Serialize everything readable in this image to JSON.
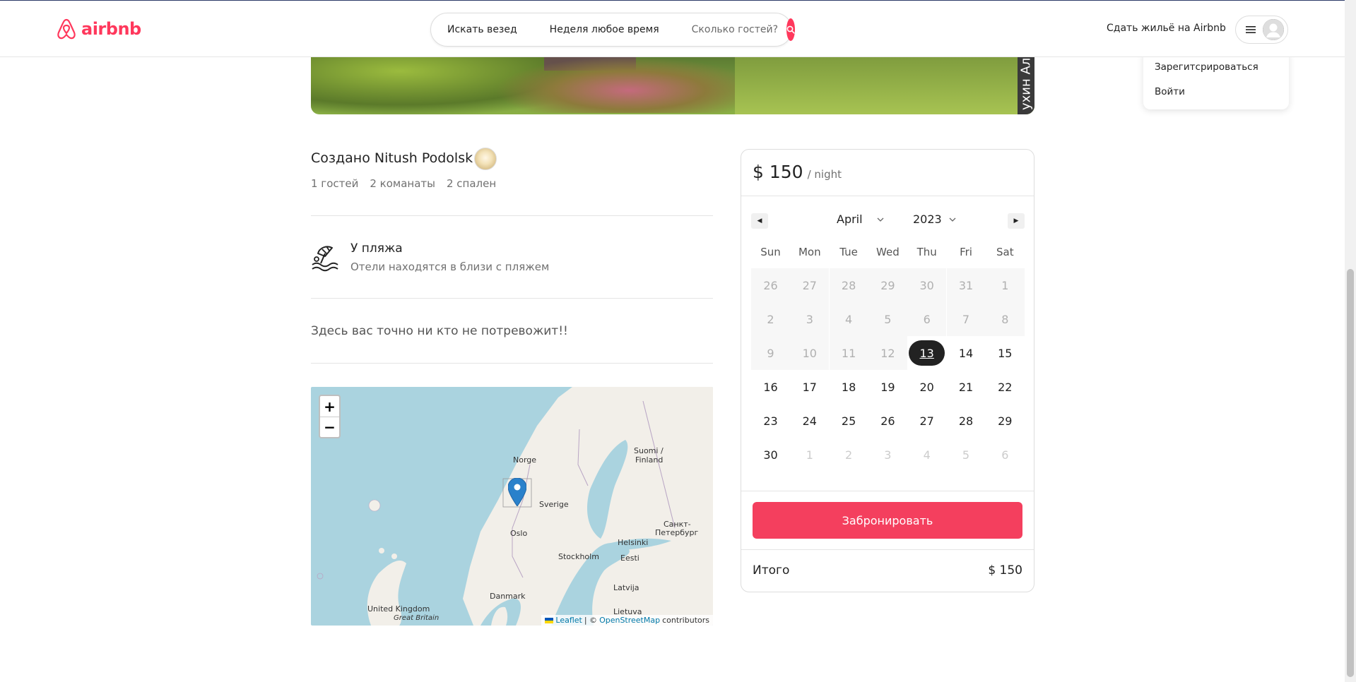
{
  "nav": {
    "logo_text": "airbnb",
    "search_anywhere": "Искать везед",
    "search_week": "Неделя любое время",
    "search_guests": "Сколько гостей?",
    "host_link": "Сдать жильё на Airbnb",
    "accent": "#ff385c"
  },
  "dropdown": {
    "items": [
      "Зарегитсрироваться",
      "Войти"
    ]
  },
  "hero": {
    "watermark": "ухин Але"
  },
  "listing": {
    "owner_title": "Создано Nitush Podolsk",
    "stats": [
      "1 гостей",
      "2 команаты",
      "2 спален"
    ],
    "amenity_title": "У пляжа",
    "amenity_sub": "Отели находятся в близи с пляжем",
    "amenity_icon": "beach-umbrella-icon",
    "description": "Здесь вас точно ни кто не потревожит!!"
  },
  "map": {
    "zoom_in": "+",
    "zoom_out": "−",
    "labels": [
      "Norge",
      "Sverige",
      "Suomi /",
      "Finland",
      "Oslo",
      "Stockholm",
      "Helsinki",
      "Санкт-",
      "Петербург",
      "Eesti",
      "Latvija",
      "Danmark",
      "United Kingdom",
      "Great Britain",
      "Lietuva"
    ],
    "attribution_leaflet": "Leaflet",
    "attribution_sep": "| ©",
    "attribution_osm": "OpenStreetMap",
    "attribution_tail": "contributors"
  },
  "booking": {
    "price": "$ 150",
    "price_unit": "/ night",
    "month": "April",
    "year": "2023",
    "weekdays": [
      "Sun",
      "Mon",
      "Tue",
      "Wed",
      "Thu",
      "Fri",
      "Sat"
    ],
    "weeks": [
      [
        "26",
        "27",
        "28",
        "29",
        "30",
        "31",
        "1"
      ],
      [
        "2",
        "3",
        "4",
        "5",
        "6",
        "7",
        "8"
      ],
      [
        "9",
        "10",
        "11",
        "12",
        "13",
        "14",
        "15"
      ],
      [
        "16",
        "17",
        "18",
        "19",
        "20",
        "21",
        "22"
      ],
      [
        "23",
        "24",
        "25",
        "26",
        "27",
        "28",
        "29"
      ],
      [
        "30",
        "1",
        "2",
        "3",
        "4",
        "5",
        "6"
      ]
    ],
    "today": "13",
    "book_button": "Забронировать",
    "total_label": "Итого",
    "total_value": "$ 150",
    "button_color": "#f43f5e"
  }
}
